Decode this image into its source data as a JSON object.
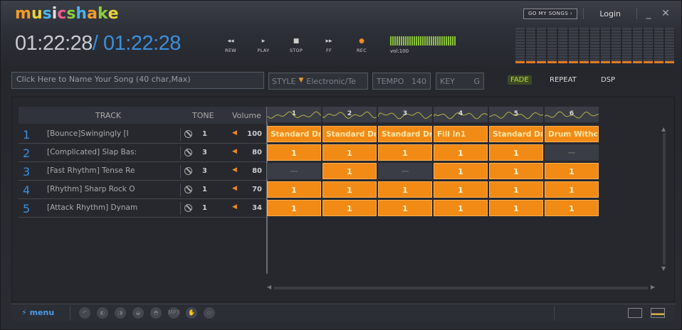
{
  "app": {
    "logo_letters": [
      {
        "ch": "m",
        "color": "#f39a2a"
      },
      {
        "ch": "u",
        "color": "#e8d33a"
      },
      {
        "ch": "s",
        "color": "#49b4e6"
      },
      {
        "ch": "i",
        "color": "#e0e0e0"
      },
      {
        "ch": "c",
        "color": "#ef5b8e"
      },
      {
        "ch": "s",
        "color": "#8ccf3a"
      },
      {
        "ch": "h",
        "color": "#49b4e6"
      },
      {
        "ch": "a",
        "color": "#f39a2a"
      },
      {
        "ch": "k",
        "color": "#8ccf3a"
      },
      {
        "ch": "e",
        "color": "#e8d33a"
      }
    ]
  },
  "header": {
    "goto_label": "GO MY SONGS",
    "goto_arrow": "›",
    "login_label": "Login",
    "minimize": "_",
    "close": "✕"
  },
  "time": {
    "current": "01:22:28",
    "separator": "/",
    "total": "01:22:28"
  },
  "transport": [
    {
      "id": "rew",
      "icon": "◂◂",
      "label": "REW"
    },
    {
      "id": "play",
      "icon": "▸",
      "label": "PLAY"
    },
    {
      "id": "stop",
      "icon": "■",
      "label": "STOP"
    },
    {
      "id": "ff",
      "icon": "▸▸",
      "label": "FF"
    },
    {
      "id": "rec",
      "icon": "●",
      "label": "REC"
    }
  ],
  "volume": {
    "label": "vol:100"
  },
  "song": {
    "name_placeholder": "Click Here to Name Your Song (40 char,Max)",
    "style_label": "STYLE",
    "style_value": "Electronic/Te",
    "tempo_label": "TEMPO",
    "tempo_value": "140",
    "key_label": "KEY",
    "key_value": "G"
  },
  "effects": {
    "fade": "FADE",
    "repeat": "REPEAT",
    "dsp": "DSP"
  },
  "columns": {
    "track": "TRACK",
    "tone": "TONE",
    "volume": "Volume"
  },
  "tracks": [
    {
      "num": "1",
      "name": "[Bounce]Swingingly    [I",
      "tone": "1",
      "volume": "100"
    },
    {
      "num": "2",
      "name": "[Complicated] Slap Bas:",
      "tone": "3",
      "volume": "80"
    },
    {
      "num": "3",
      "name": "[Fast Rhythm] Tense Re",
      "tone": "3",
      "volume": "80"
    },
    {
      "num": "4",
      "name": "[Rhythm] Sharp Rock O",
      "tone": "1",
      "volume": "70"
    },
    {
      "num": "5",
      "name": "[Attack Rhythm] Dynam",
      "tone": "1",
      "volume": "34"
    }
  ],
  "blocks": [
    "1",
    "2",
    "3",
    "4",
    "5",
    "6"
  ],
  "grid": [
    [
      "Standard Dr",
      "Standard Dr",
      "Standard Dr",
      "Fill In1",
      "Standard Dr",
      "Drum Withc"
    ],
    [
      "1",
      "1",
      "1",
      "1",
      "1",
      "—"
    ],
    [
      "—",
      "1",
      "—",
      "1",
      "1",
      "1"
    ],
    [
      "1",
      "1",
      "1",
      "1",
      "1",
      "1"
    ],
    [
      "1",
      "1",
      "1",
      "1",
      "1",
      "1"
    ]
  ],
  "bottom": {
    "menu_label": "menu",
    "menu_icon": "⚡",
    "tools": [
      "↶",
      "◐",
      "◑",
      "◒",
      "◓",
      "MP3",
      "✋",
      "▭"
    ]
  }
}
